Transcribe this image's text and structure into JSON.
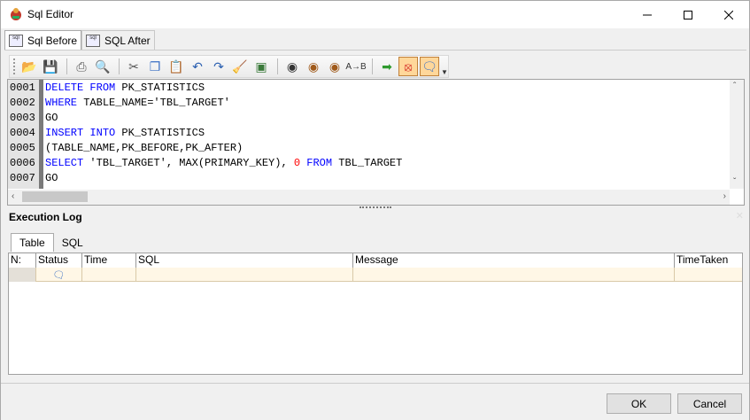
{
  "window": {
    "title": "Sql Editor"
  },
  "tabs": [
    {
      "label": "Sql Before"
    },
    {
      "label": "SQL After"
    }
  ],
  "editor": {
    "lines": [
      {
        "num": "0001",
        "parts": [
          {
            "t": "DELETE",
            "k": "kw"
          },
          {
            "t": " "
          },
          {
            "t": "FROM",
            "k": "kw"
          },
          {
            "t": " PK_STATISTICS"
          }
        ]
      },
      {
        "num": "0002",
        "parts": [
          {
            "t": "WHERE",
            "k": "kw"
          },
          {
            "t": " TABLE_NAME='TBL_TARGET'"
          }
        ]
      },
      {
        "num": "0003",
        "parts": [
          {
            "t": "GO"
          }
        ]
      },
      {
        "num": "0004",
        "parts": [
          {
            "t": "INSERT",
            "k": "kw"
          },
          {
            "t": " "
          },
          {
            "t": "INTO",
            "k": "kw"
          },
          {
            "t": " PK_STATISTICS"
          }
        ]
      },
      {
        "num": "0005",
        "parts": [
          {
            "t": "(TABLE_NAME,PK_BEFORE,PK_AFTER)"
          }
        ]
      },
      {
        "num": "0006",
        "parts": [
          {
            "t": "SELECT",
            "k": "kw"
          },
          {
            "t": " 'TBL_TARGET', MAX(PRIMARY_KEY), "
          },
          {
            "t": "0",
            "k": "num"
          },
          {
            "t": " "
          },
          {
            "t": "FROM",
            "k": "kw"
          },
          {
            "t": " TBL_TARGET"
          }
        ]
      },
      {
        "num": "0007",
        "parts": [
          {
            "t": "GO"
          }
        ]
      }
    ]
  },
  "log": {
    "title": "Execution Log",
    "tabs": [
      {
        "label": "Table"
      },
      {
        "label": "SQL"
      }
    ],
    "columns": [
      "N:",
      "Status",
      "Time",
      "SQL",
      "Message",
      "TimeTaken"
    ]
  },
  "buttons": {
    "ok": "OK",
    "cancel": "Cancel"
  },
  "colors": {
    "keyword": "#0000ff",
    "number": "#ff0000",
    "row_highlight": "#fff7e6"
  }
}
